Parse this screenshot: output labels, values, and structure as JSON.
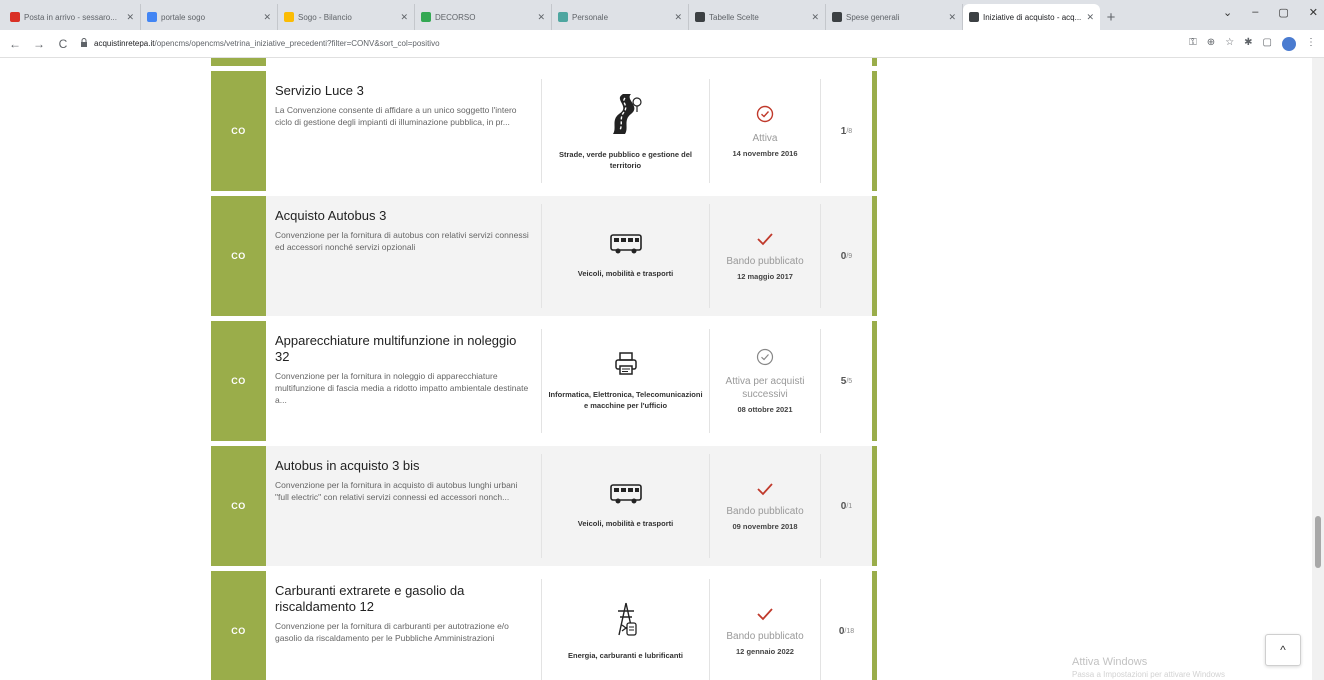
{
  "browser": {
    "tabs": [
      {
        "title": "Posta in arrivo - sessaro...",
        "color": "#d93025"
      },
      {
        "title": "portale sogo",
        "color": "#4285f4"
      },
      {
        "title": "Sogo - Bilancio",
        "color": "#fbbc04"
      },
      {
        "title": "DECORSO",
        "color": "#34a853"
      },
      {
        "title": "Personale",
        "color": "#4ea6a0"
      },
      {
        "title": "Tabelle Scelte",
        "color": "#3c4043"
      },
      {
        "title": "Spese generali",
        "color": "#3c4043"
      },
      {
        "title": "Iniziative di acquisto - acq...",
        "color": "#3c4043"
      }
    ],
    "new_tab": "+",
    "window_controls": [
      "⌄",
      "–",
      "▢",
      "✕"
    ],
    "url_host": "acquistinretepa.it",
    "url_path": "/opencms/opencms/vetrina_iniziative_precedenti?filter=CONV&sort_col=positivo",
    "nav": {
      "back": "←",
      "forward": "→",
      "reload": "C"
    }
  },
  "page": {
    "cards": [
      {
        "badge": "CO",
        "title": "Servizio Luce 3",
        "description": "La Convenzione consente di affidare a un unico soggetto l'intero ciclo di gestione degli impianti di illuminazione pubblica, in pr...",
        "category": "Strade, verde pubblico e gestione del territorio",
        "category_icon": "road-icon",
        "status": "Attiva",
        "status_icon": "check-circle-icon",
        "date": "14 novembre 2016",
        "count": "1",
        "count_total": "/8",
        "shade": "white"
      },
      {
        "badge": "CO",
        "title": "Acquisto Autobus 3",
        "description": "Convenzione per la fornitura di autobus con relativi servizi connessi ed accessori nonché servizi opzionali",
        "category": "Veicoli, mobilità e trasporti",
        "category_icon": "bus-icon",
        "status": "Bando pubblicato",
        "status_icon": "checkmark-icon",
        "date": "12 maggio 2017",
        "count": "0",
        "count_total": "/9",
        "shade": "grey"
      },
      {
        "badge": "CO",
        "title": "Apparecchiature multifunzione in noleggio 32",
        "description": "Convenzione per la fornitura in noleggio di apparecchiature multifunzione di fascia media a ridotto impatto ambientale destinate a...",
        "category": "Informatica, Elettronica, Telecomunicazioni e macchine per l'ufficio",
        "category_icon": "printer-icon",
        "status": "Attiva per acquisti successivi",
        "status_icon": "check-circle-grey-icon",
        "date": "08 ottobre 2021",
        "count": "5",
        "count_total": "/5",
        "shade": "white"
      },
      {
        "badge": "CO",
        "title": "Autobus in acquisto 3 bis",
        "description": "Convenzione per la fornitura in acquisto di autobus lunghi urbani \"full electric\" con relativi servizi connessi ed accessori nonch...",
        "category": "Veicoli, mobilità e trasporti",
        "category_icon": "bus-icon",
        "status": "Bando pubblicato",
        "status_icon": "checkmark-icon",
        "date": "09 novembre 2018",
        "count": "0",
        "count_total": "/1",
        "shade": "grey"
      },
      {
        "badge": "CO",
        "title": "Carburanti extrarete e gasolio da riscaldamento 12",
        "description": "Convenzione per la fornitura di carburanti per autotrazione e/o gasolio da riscaldamento per le Pubbliche Amministrazioni",
        "category": "Energia, carburanti e lubrificanti",
        "category_icon": "energy-pylon-icon",
        "status": "Bando pubblicato",
        "status_icon": "checkmark-icon",
        "date": "12 gennaio 2022",
        "count": "0",
        "count_total": "/18",
        "shade": "white"
      }
    ],
    "back_to_top": "^",
    "windows_watermark": "Attiva Windows",
    "windows_watermark_sub": "Passa a Impostazioni per attivare Windows",
    "colors": {
      "accent": "#9aad4a",
      "status_red": "#c0392b"
    }
  }
}
